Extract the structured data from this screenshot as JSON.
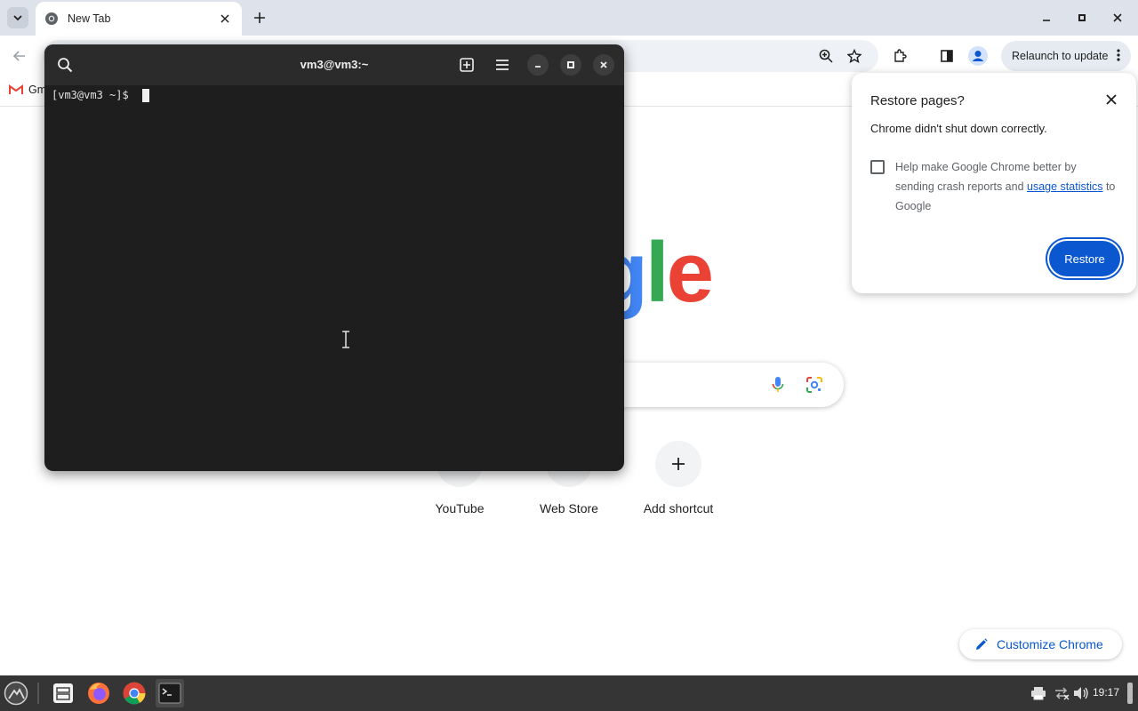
{
  "browser": {
    "tab": {
      "title": "New Tab"
    },
    "bookmarks": {
      "gmail_label": "Gm"
    },
    "relaunch_label": "Relaunch to update",
    "icons": [
      "tab-search-icon",
      "chrome-favicon-icon",
      "close-icon",
      "plus-icon",
      "minimize-icon",
      "maximize-icon",
      "back-arrow-icon",
      "zoom-icon",
      "star-icon",
      "extensions-icon",
      "side-panel-icon",
      "profile-icon",
      "kebab-menu-icon"
    ]
  },
  "ntp": {
    "logo_visible": [
      "g",
      "l",
      "e"
    ],
    "shortcuts": [
      {
        "label": "YouTube"
      },
      {
        "label": "Web Store"
      },
      {
        "label": "Add shortcut"
      }
    ],
    "customize_label": "Customize Chrome",
    "icons": [
      "microphone-icon",
      "google-lens-icon",
      "pencil-icon"
    ]
  },
  "restore_popup": {
    "title": "Restore pages?",
    "message": "Chrome didn't shut down correctly.",
    "checkbox_text_before": "Help make Google Chrome better by sending crash reports and ",
    "checkbox_link": "usage statistics",
    "checkbox_text_after": " to Google",
    "checked": false,
    "button_label": "Restore",
    "accent_color": "#0b57d0"
  },
  "terminal": {
    "title": "vm3@vm3:~",
    "prompt": "[vm3@vm3 ~]$ ",
    "background_color": "#1e1e1e",
    "icons": [
      "search-icon",
      "new-tab-icon",
      "hamburger-menu-icon",
      "minimize-icon",
      "maximize-icon",
      "close-icon"
    ]
  },
  "taskbar": {
    "clock": "19:17",
    "apps": [
      "app-menu-icon",
      "file-manager-icon",
      "firefox-icon",
      "chrome-icon",
      "terminal-icon"
    ],
    "tray": [
      "printer-icon",
      "network-icon",
      "volume-icon"
    ]
  }
}
